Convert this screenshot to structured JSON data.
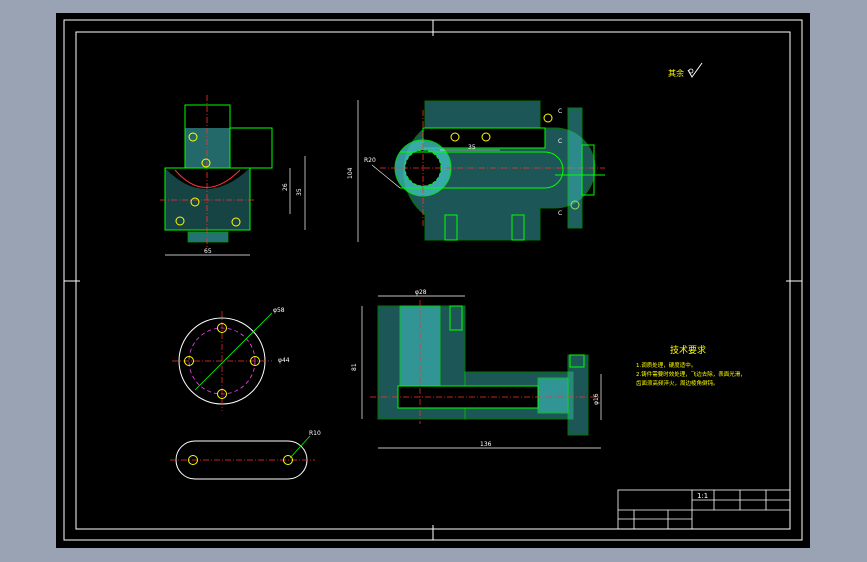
{
  "colors": {
    "background": "#9aa3b3",
    "sheet": "#000000",
    "border": "#ffffff",
    "outline": "#00ff00",
    "hatch": "#3fbfbf",
    "dimension": "#ffffff",
    "centerline": "#ff3030",
    "hidden_circle": "#ff40ff",
    "leader": "#00ff00",
    "hole": "#ffff00"
  },
  "drawing": {
    "roughness_note": "其余",
    "dimensions": {
      "front_width": "65",
      "front_height_a": "26",
      "front_height_b": "35",
      "top_height": "104",
      "top_slot": "35",
      "top_radius": "R20",
      "section_width": "φ28",
      "section_height": "81",
      "section_length": "136",
      "section_diameter": "φ16",
      "flange_diameter": "φ58",
      "flange_pcd": "φ44",
      "slot_radius": "R10"
    },
    "side_labels": [
      "C",
      "C",
      "C"
    ]
  },
  "notes": {
    "title": "技术要求",
    "lines": [
      "1.调质处理，硬度适中。",
      "2.铸件需要时效处理，飞边去除，表面光滑，",
      "齿面须高频淬火，周边棱角倒钝。"
    ]
  },
  "title_block": {
    "scale": "1:1"
  }
}
